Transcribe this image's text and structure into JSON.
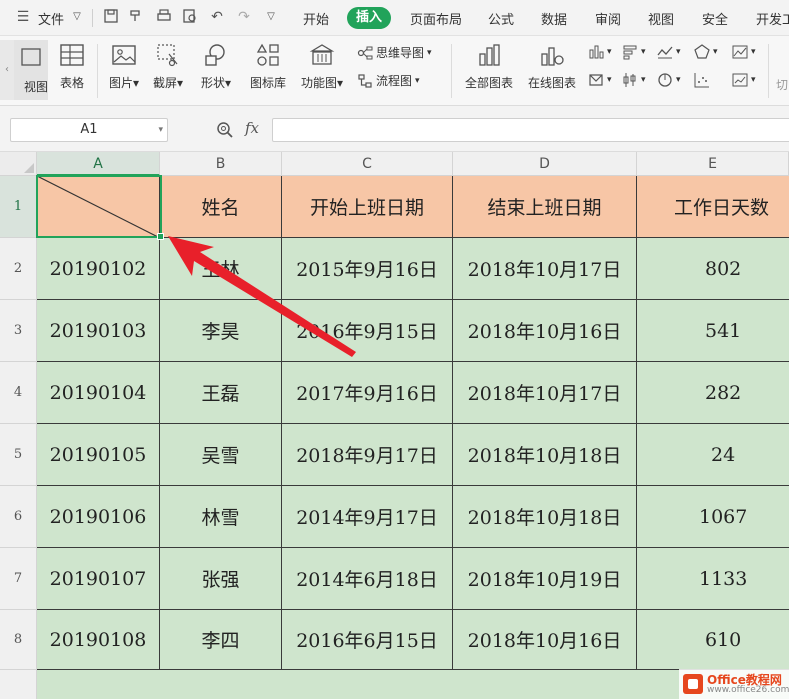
{
  "menu": {
    "file_label": "文件",
    "tabs": [
      {
        "label": "开始"
      },
      {
        "label": "插入"
      },
      {
        "label": "页面布局"
      },
      {
        "label": "公式"
      },
      {
        "label": "数据"
      },
      {
        "label": "审阅"
      },
      {
        "label": "视图"
      },
      {
        "label": "安全"
      },
      {
        "label": "开发工"
      }
    ],
    "active_tab": "插入"
  },
  "ribbon": {
    "view_label": "视图",
    "table_label": "表格",
    "picture_label": "图片",
    "screenshot_label": "截屏",
    "shape_label": "形状",
    "iconlib_label": "图标库",
    "funcmap_label": "功能图",
    "mindmap_label": "思维导图",
    "flowchart_label": "流程图",
    "allcharts_label": "全部图表",
    "onlinechart_label": "在线图表",
    "cut_label": "切"
  },
  "formula_bar": {
    "name_box": "A1",
    "fx_label": "fx",
    "formula": ""
  },
  "grid": {
    "columns": [
      "A",
      "B",
      "C",
      "D",
      "E"
    ],
    "rows": [
      "1",
      "2",
      "3",
      "4",
      "5",
      "6",
      "7",
      "8"
    ],
    "header": [
      "",
      "姓名",
      "开始上班日期",
      "结束上班日期",
      "工作日天数"
    ],
    "data": [
      [
        "20190102",
        "王林",
        "2015年9月16日",
        "2018年10月17日",
        "802"
      ],
      [
        "20190103",
        "李昊",
        "2016年9月15日",
        "2018年10月16日",
        "541"
      ],
      [
        "20190104",
        "王磊",
        "2017年9月16日",
        "2018年10月17日",
        "282"
      ],
      [
        "20190105",
        "吴雪",
        "2018年9月17日",
        "2018年10月18日",
        "24"
      ],
      [
        "20190106",
        "林雪",
        "2014年9月17日",
        "2018年10月18日",
        "1067"
      ],
      [
        "20190107",
        "张强",
        "2014年6月18日",
        "2018年10月19日",
        "1133"
      ],
      [
        "20190108",
        "李四",
        "2016年6月15日",
        "2018年10月16日",
        "610"
      ]
    ]
  },
  "colors": {
    "accent": "#21a35a",
    "header_fill": "#f7c6a6",
    "data_fill": "#cfe5cd",
    "arrow": "#e8202a"
  },
  "watermark": {
    "title": "Office教程网",
    "url": "www.office26.com"
  }
}
